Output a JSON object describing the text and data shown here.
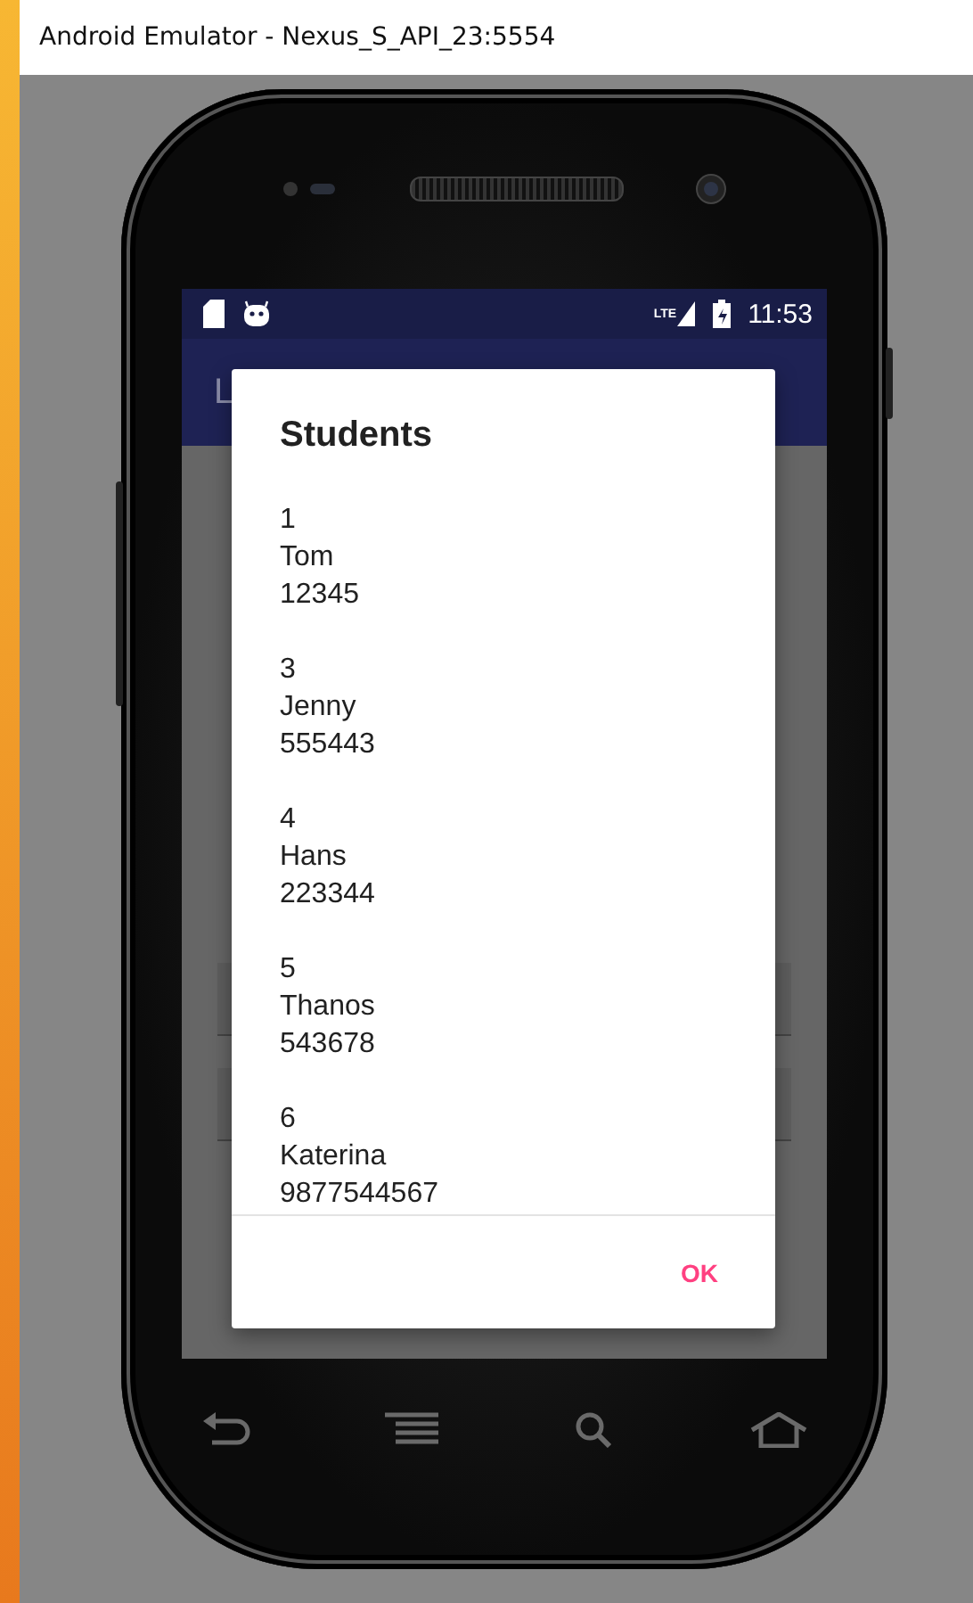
{
  "window": {
    "title": "Android Emulator - Nexus_S_API_23:5554"
  },
  "status_bar": {
    "network": "LTE",
    "time": "11:53"
  },
  "background_app": {
    "toolbar_title": "L"
  },
  "dialog": {
    "title": "Students",
    "students": [
      {
        "id": "1",
        "name": "Tom",
        "number": "12345"
      },
      {
        "id": "3",
        "name": "Jenny",
        "number": "555443"
      },
      {
        "id": "4",
        "name": "Hans",
        "number": "223344"
      },
      {
        "id": "5",
        "name": "Thanos",
        "number": "543678"
      },
      {
        "id": "6",
        "name": "Katerina",
        "number": "9877544567"
      }
    ],
    "buttons": [
      "OK"
    ]
  }
}
